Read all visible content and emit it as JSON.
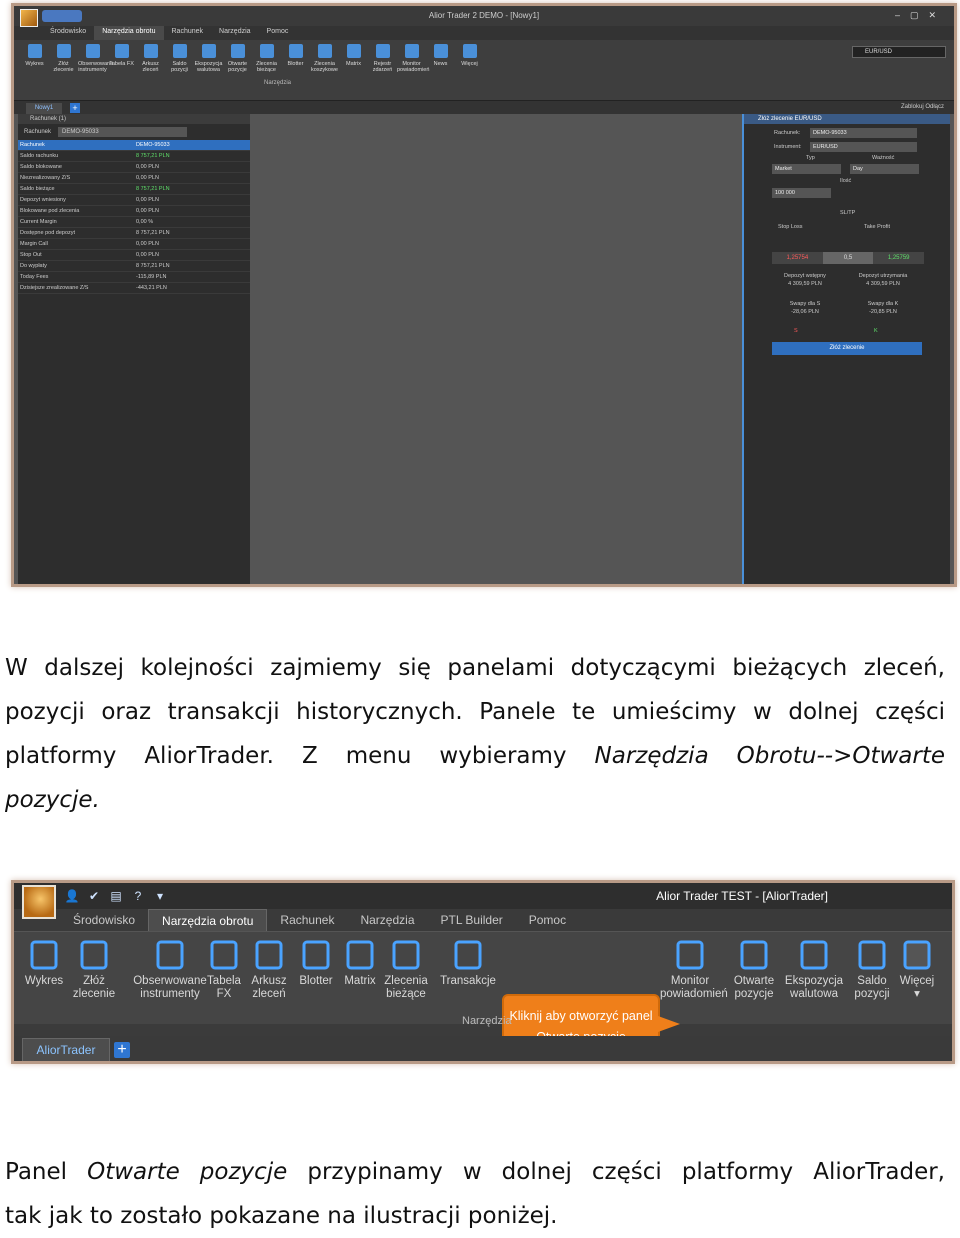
{
  "shot1": {
    "window_title": "Alior Trader 2 DEMO - [Nowy1]",
    "tabs": [
      "Środowisko",
      "Narzędzia obrotu",
      "Rachunek",
      "Narzędzia",
      "Pomoc"
    ],
    "tools": [
      "Wykres",
      "Złóż zlecenie",
      "Obserwowane instrumenty",
      "Tabela FX",
      "Arkusz zleceń",
      "Saldo pozycji",
      "Ekspozycja walutowa",
      "Otwarte pozycje",
      "Zlecenia bieżące",
      "Blotter",
      "Zlecenia koszykowe",
      "Matrix",
      "Rejestr zdarzeń",
      "Monitor powiadomień",
      "News",
      "Więcej"
    ],
    "group_label": "Narzędzia",
    "search_value": "EUR/USD",
    "tab_new": "Nowy1",
    "links": "Zablokuj   Odłącz",
    "account_panel": {
      "title": "Rachunek (1)",
      "account_label": "Rachunek",
      "account_value": "DEMO-95033",
      "rows": [
        {
          "k": "Rachunek",
          "v": "DEMO-95033"
        },
        {
          "k": "Saldo rachunku",
          "v": "8 757,21 PLN"
        },
        {
          "k": "Saldo blokowane",
          "v": "0,00 PLN"
        },
        {
          "k": "Niezrealizowany Z/S",
          "v": "0,00 PLN"
        },
        {
          "k": "Saldo bieżące",
          "v": "8 757,21 PLN"
        },
        {
          "k": "Depozyt wniesiony",
          "v": "0,00 PLN"
        },
        {
          "k": "Blokowane pod zlecenia",
          "v": "0,00 PLN"
        },
        {
          "k": "Current Margin",
          "v": "0,00 %"
        },
        {
          "k": "Dostępne pod depozyt",
          "v": "8 757,21 PLN"
        },
        {
          "k": "Margin Call",
          "v": "0,00 PLN"
        },
        {
          "k": "Stop Out",
          "v": "0,00 PLN"
        },
        {
          "k": "Do wypłaty",
          "v": "8 757,21 PLN"
        },
        {
          "k": "Today Fees",
          "v": "-115,89 PLN"
        },
        {
          "k": "Dzisiejsze zrealizowane Z/S",
          "v": "-443,21 PLN"
        }
      ]
    },
    "order_panel": {
      "title": "Złóż zlecenie EUR/USD",
      "account_label": "Rachunek:",
      "account_value": "DEMO-95033",
      "instrument_label": "Instrument:",
      "instrument_value": "EUR/USD",
      "type_label": "Typ",
      "type_value": "Market",
      "validity_label": "Ważność",
      "validity_value": "Day",
      "qty_label": "Ilość",
      "qty_value": "100 000",
      "sltp_label": "SL/TP",
      "stop_loss": "Stop Loss",
      "take_profit": "Take Profit",
      "bid": "1,25754",
      "spread": "0,5",
      "ask": "1,25759",
      "deposit_initial_label": "Depozyt wstępny",
      "deposit_initial": "4 309,59 PLN",
      "deposit_maint_label": "Depozyt utrzymania",
      "deposit_maint": "4 309,59 PLN",
      "swap_s_label": "Swapy dla S",
      "swap_s": "-28,06 PLN",
      "swap_k_label": "Swapy dla K",
      "swap_k": "-20,85 PLN",
      "side_s": "S",
      "side_k": "K",
      "submit": "Złóż zlecenie"
    }
  },
  "paragraph1": {
    "line1": "W dalszej kolejności zajmiemy się panelami dotyczącymi bieżących zleceń,",
    "line2": "pozycji oraz transakcji historycznych. Panele te umieścimy w dolnej części",
    "line3": "platformy AliorTrader. Z menu wybieramy ",
    "line3_em": "Narzędzia Obrotu-->Otwarte",
    "line4_em": "pozycje."
  },
  "shot2": {
    "window_title": "Alior Trader TEST - [AliorTrader]",
    "tabs": [
      "Środowisko",
      "Narzędzia obrotu",
      "Rachunek",
      "Narzędzia",
      "PTL Builder",
      "Pomoc"
    ],
    "tools": [
      {
        "label1": "Wykres",
        "label2": ""
      },
      {
        "label1": "Złóż",
        "label2": "zlecenie"
      },
      {
        "label1": "Obserwowane",
        "label2": "instrumenty"
      },
      {
        "label1": "Tabela",
        "label2": "FX"
      },
      {
        "label1": "Arkusz",
        "label2": "zleceń"
      },
      {
        "label1": "Blotter",
        "label2": ""
      },
      {
        "label1": "Matrix",
        "label2": ""
      },
      {
        "label1": "Zlecenia",
        "label2": "bieżące"
      },
      {
        "label1": "Transakcje",
        "label2": ""
      },
      {
        "label1": "Monitor",
        "label2": "powiadomień"
      },
      {
        "label1": "Otwarte",
        "label2": "pozycje"
      },
      {
        "label1": "Ekspozycja",
        "label2": "walutowa"
      },
      {
        "label1": "Saldo",
        "label2": "pozycji"
      },
      {
        "label1": "Więcej",
        "label2": "▾"
      }
    ],
    "callout_line1": "Kliknij aby otworzyć panel",
    "callout_line2": "Otwarte pozycje",
    "group_label": "Narzędzia",
    "tab_aliortrader": "AliorTrader",
    "plus": "+"
  },
  "paragraph2": {
    "line1_a": "Panel ",
    "line1_em": "Otwarte pozycje",
    "line1_b": " przypinamy w dolnej części platformy AliorTrader,",
    "line2": "tak jak to zostało pokazane na ilustracji poniżej."
  }
}
